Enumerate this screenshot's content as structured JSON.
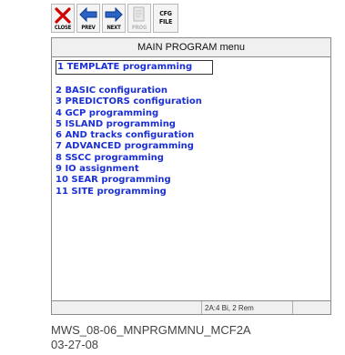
{
  "toolbar": {
    "buttons": [
      {
        "label": "CLOSE",
        "icon": "close-x-icon"
      },
      {
        "label": "PREV",
        "icon": "arrow-left-icon"
      },
      {
        "label": "NEXT",
        "icon": "arrow-right-icon"
      },
      {
        "label": "PROG",
        "icon": "document-icon",
        "disabled": true
      },
      {
        "label_line1": "CFG",
        "label_line2": "FILE"
      }
    ]
  },
  "window": {
    "title": "MAIN PROGRAM menu",
    "menu_items": [
      "1 TEMPLATE programming",
      "2 BASIC configuration",
      "3 PREDICTORS configuration",
      "4 GCP programming",
      "5 ISLAND programming",
      "6 AND tracks configuration",
      "7 ADVANCED programming",
      "8 SSCC programming",
      "9 IO assignment",
      "10 SEAR programming",
      "11 SITE programming"
    ],
    "status": "2A:4 Bi, 2 Rem"
  },
  "caption": {
    "line1": "MWS_08-06_MNPRGMMNU_MCF2A",
    "line2": "03-27-08"
  },
  "colors": {
    "menu_text": "#1a2fd6",
    "close_red": "#d10000",
    "arrow_blue": "#2b63c6"
  }
}
